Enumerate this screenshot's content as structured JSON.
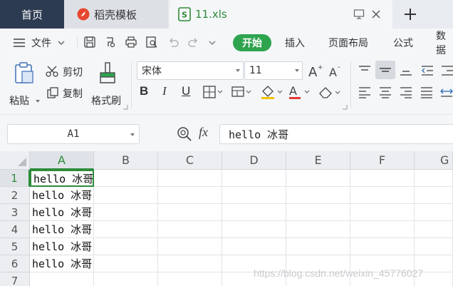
{
  "tabs": {
    "home": "首页",
    "template": "稻壳模板",
    "file": "11.xls"
  },
  "menu": {
    "hamburger_label": "文件",
    "items": [
      "开始",
      "插入",
      "页面布局",
      "公式",
      "数据"
    ]
  },
  "ribbon": {
    "paste": "粘贴",
    "cut": "剪切",
    "copy": "复制",
    "format_painter": "格式刷",
    "font_name": "宋体",
    "font_size": "11",
    "bold": "B",
    "italic": "I",
    "underline": "U"
  },
  "formula": {
    "cell_ref": "A1",
    "fx": "fx",
    "value": "hello 冰哥"
  },
  "sheet": {
    "columns": [
      "A",
      "B",
      "C",
      "D",
      "E",
      "F",
      "G"
    ],
    "rows": [
      "1",
      "2",
      "3",
      "4",
      "5",
      "6",
      "7"
    ],
    "cells_a": [
      "hello 冰哥",
      "hello 冰哥",
      "hello 冰哥",
      "hello 冰哥",
      "hello 冰哥",
      "hello 冰哥",
      ""
    ]
  },
  "watermark": "https://blog.csdn.net/weixin_45776027",
  "colors": {
    "accent_green": "#2ea44f",
    "home_tab": "#2d3b52"
  }
}
